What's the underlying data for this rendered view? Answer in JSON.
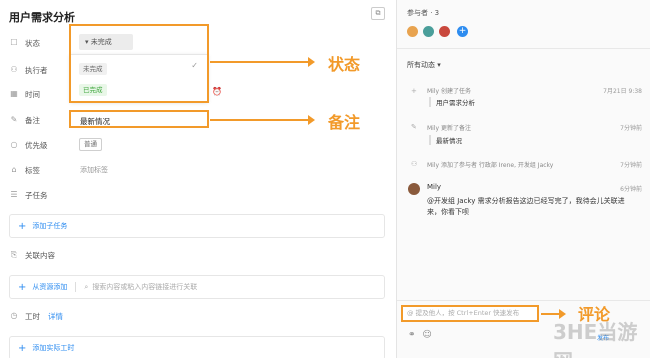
{
  "task": {
    "title": "用户需求分析",
    "fields": {
      "status_label": "状态",
      "assignee_label": "执行者",
      "time_label": "时间",
      "note_label": "备注",
      "priority_label": "优先级",
      "tags_label": "标签",
      "subtasks_label": "子任务",
      "related_label": "关联内容",
      "worktime_label": "工时"
    },
    "status_value": "未完成",
    "status_options": [
      "未完成",
      "已完成"
    ],
    "note_value": "最新情况",
    "priority_value": "普通",
    "add_tag": "添加标签",
    "add_subtask": "添加子任务",
    "add_from_resource": "从资源添加",
    "search_placeholder": "搜索内容或粘入内容链接进行关联",
    "worktime_detail": "详情",
    "add_worktime": "添加实际工时"
  },
  "annotations": {
    "status": "状态",
    "note": "备注",
    "comment": "评论"
  },
  "sidebar": {
    "participants_header": "参与者 · 3",
    "all_activity": "所有动态",
    "activities": [
      {
        "text": "Mily 创建了任务",
        "time": "7月21日 9:38",
        "quote": "用户需求分析"
      },
      {
        "text": "Mily 更新了备注",
        "time": "7分钟前",
        "quote": "最新情况"
      },
      {
        "text": "Mily 添加了参与者 行政部 Irene, 开发组 Jacky",
        "time": "7分钟前"
      }
    ],
    "comment_author": "Mily",
    "comment_time": "6分钟前",
    "comment_text": "@开发组 Jacky 需求分析报告这边已经写完了，我待会儿关联进来，你看下呗",
    "comment_placeholder": "@ 提及他人，按 Ctrl+Enter 快速发布",
    "send_label": "发布"
  },
  "watermark": "3HE当游网",
  "colors": {
    "accent": "#f29a2a",
    "link": "#2d8cf0",
    "done_green": "#3ea63d"
  }
}
